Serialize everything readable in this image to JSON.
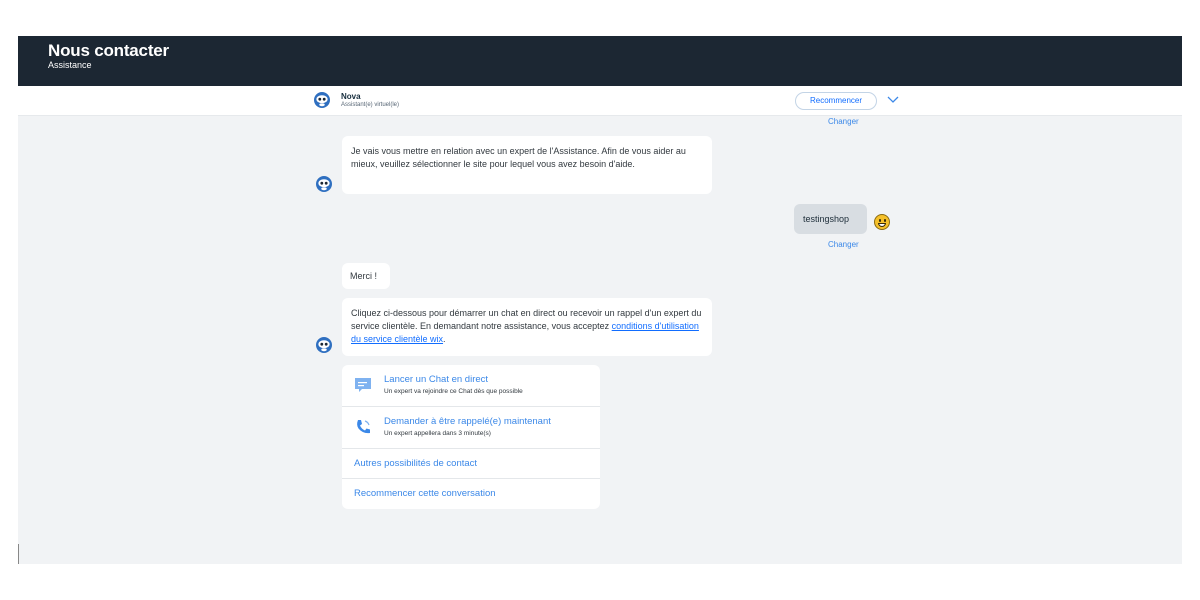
{
  "header": {
    "title": "Nous contacter",
    "subtitle": "Assistance"
  },
  "bot": {
    "name": "Nova",
    "role": "Assistant(e) virtuel(le)",
    "avatar_icon": "robot-avatar-icon"
  },
  "toolbar": {
    "restart_label": "Recommencer",
    "collapse_icon": "chevron-down-icon"
  },
  "conversation": {
    "change_label": "Changer",
    "bot_message_1": "Je vais vous mettre en relation avec un expert de l'Assistance. Afin de vous aider au mieux, veuillez sélectionner le site pour lequel vous avez besoin d'aide.",
    "user_reply": "testingshop",
    "user_avatar_icon": "smiley-emoji-icon",
    "bot_message_2": "Merci !",
    "bot_message_3_text": "Cliquez ci-dessous pour démarrer un chat en direct ou recevoir un rappel d'un expert du service clientèle. En demandant notre assistance, vous acceptez ",
    "bot_message_3_link": "conditions d'utilisation du service clientèle wix",
    "bot_message_3_end": "."
  },
  "options": [
    {
      "title": "Lancer un Chat en direct",
      "subtitle": "Un expert va rejoindre ce Chat dès que possible",
      "icon": "chat-bubble-icon"
    },
    {
      "title": "Demander à être rappelé(e) maintenant",
      "subtitle": "Un expert appellera dans 3 minute(s)",
      "icon": "phone-icon"
    },
    {
      "title": "Autres possibilités de contact"
    },
    {
      "title": "Recommencer cette conversation"
    }
  ],
  "colors": {
    "header_bg": "#1c2733",
    "accent": "#116dff",
    "link": "#3b88e8",
    "chat_bg": "#f1f3f5",
    "user_bubble": "#d8dde2"
  }
}
